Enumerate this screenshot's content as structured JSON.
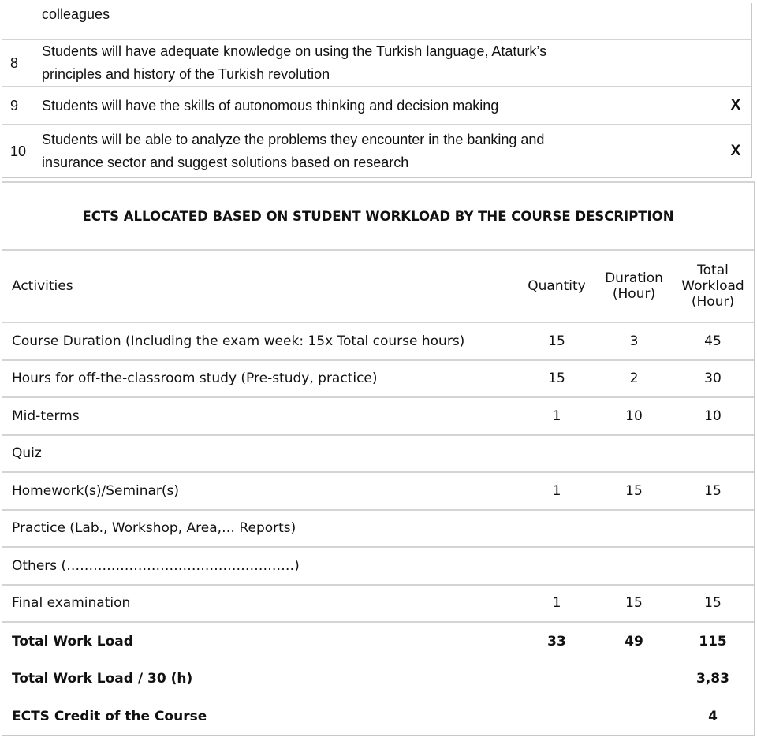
{
  "outcomes": [
    {
      "num": "",
      "text": "colleagues",
      "mark": ""
    },
    {
      "num": "8",
      "text": "Students will have adequate knowledge on using the Turkish language, Ataturk’s principles and history of the Turkish revolution",
      "mark": ""
    },
    {
      "num": "9",
      "text": "Students will have the skills of autonomous thinking and decision making",
      "mark": "X"
    },
    {
      "num": "10",
      "text": "Students will be able to analyze the problems they encounter in the banking and insurance sector and suggest solutions based on research",
      "mark": "X"
    }
  ],
  "ects": {
    "title": "ECTS ALLOCATED BASED ON STUDENT WORKLOAD BY THE COURSE DESCRIPTION",
    "headers": {
      "activities": "Activities",
      "quantity": "Quantity",
      "duration_1": "Duration",
      "duration_2": "(Hour)",
      "total_1": "Total",
      "total_2": "Workload",
      "total_3": "(Hour)"
    },
    "rows": [
      {
        "activity": "Course Duration (Including the exam week: 15x Total course hours)",
        "quantity": "15",
        "duration": "3",
        "total": "45"
      },
      {
        "activity": "Hours for off-the-classroom study (Pre-study, practice)",
        "quantity": "15",
        "duration": "2",
        "total": "30"
      },
      {
        "activity": "Mid-terms",
        "quantity": "1",
        "duration": "10",
        "total": "10"
      },
      {
        "activity": "Quiz",
        "quantity": "",
        "duration": "",
        "total": ""
      },
      {
        "activity": "Homework(s)/Seminar(s)",
        "quantity": "1",
        "duration": "15",
        "total": "15"
      },
      {
        "activity": "Practice (Lab., Workshop, Area,… Reports)",
        "quantity": "",
        "duration": "",
        "total": ""
      },
      {
        "activity": "Others (……………………………………………)",
        "quantity": "",
        "duration": "",
        "total": ""
      },
      {
        "activity": "Final examination",
        "quantity": "1",
        "duration": "15",
        "total": "15"
      }
    ],
    "totals": [
      {
        "label": "Total Work Load",
        "quantity": "33",
        "duration": "49",
        "total": "115"
      },
      {
        "label": "Total Work Load / 30 (h)",
        "quantity": "",
        "duration": "",
        "total": "3,83"
      },
      {
        "label": "ECTS Credit of the Course",
        "quantity": "",
        "duration": "",
        "total": "4"
      }
    ]
  }
}
